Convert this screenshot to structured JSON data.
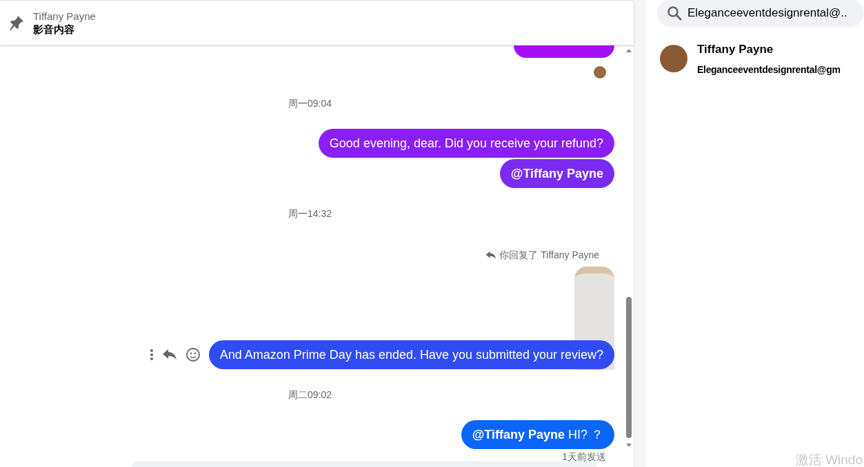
{
  "header": {
    "pinned_by": "Tiffany Payne",
    "title": "影音内容"
  },
  "messages": [
    {
      "kind": "bubble_cut",
      "color": "#a20ff5"
    },
    {
      "kind": "seen_avatar"
    },
    {
      "kind": "timestamp",
      "text": "周一09:04"
    },
    {
      "kind": "bubble",
      "text": "Good evening, dear. Did you receive your refund?",
      "color": "#8a1ff2"
    },
    {
      "kind": "bubble",
      "text": "**@Tiffany Payne**",
      "color": "#7a2bf2"
    },
    {
      "kind": "timestamp",
      "text": "周一14:32"
    },
    {
      "kind": "reply_note",
      "text": "你回复了 Tiffany Payne"
    },
    {
      "kind": "image"
    },
    {
      "kind": "bubble",
      "text": "And Amazon Prime Day has ended. Have you submitted your review?",
      "color": "#2f4cf2",
      "hovered": true
    },
    {
      "kind": "timestamp",
      "text": "周二09:02"
    },
    {
      "kind": "bubble",
      "text": "**@Tiffany Payne** HI? ？",
      "color": "#0b66f7"
    },
    {
      "kind": "status",
      "text": "1天前发送"
    }
  ],
  "search": {
    "value": "Eleganceeventdesignrental@.."
  },
  "contact": {
    "name": "Tiffany Payne",
    "email": "Eleganceeventdesignrental@gm"
  },
  "system_notice": "激活 Windo"
}
